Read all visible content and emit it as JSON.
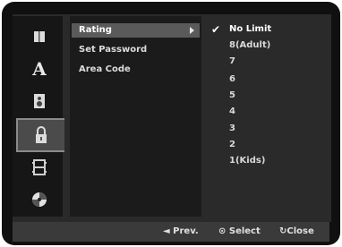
{
  "menu": {
    "items": [
      {
        "label": "Rating",
        "active": true
      },
      {
        "label": "Set Password",
        "active": false
      },
      {
        "label": "Area Code",
        "active": false
      }
    ]
  },
  "icons": [
    {
      "name": "disc-menu-icon",
      "glyph": "▌"
    },
    {
      "name": "language-icon",
      "glyph": "A"
    },
    {
      "name": "speaker-icon",
      "glyph": ""
    },
    {
      "name": "lock-icon",
      "glyph": ""
    },
    {
      "name": "film-icon",
      "glyph": ""
    },
    {
      "name": "others-icon",
      "glyph": ""
    }
  ],
  "options": {
    "checkmark": "✔",
    "items": [
      "No Limit",
      "8(Adult)",
      "7",
      "6",
      "5",
      "4",
      "3",
      "2",
      "1(Kids)"
    ],
    "selected": "No Limit"
  },
  "footer": {
    "prev": "◄ Prev.",
    "select": "⊙ Select",
    "close": "Close"
  }
}
